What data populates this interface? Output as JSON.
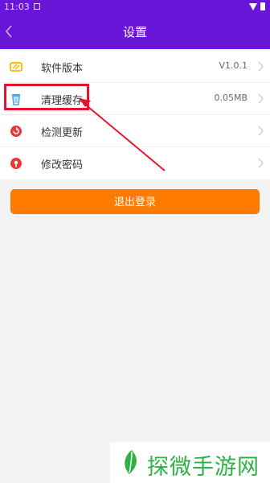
{
  "status_bar": {
    "time": "11:03"
  },
  "header": {
    "title": "设置"
  },
  "settings": [
    {
      "label": "软件版本",
      "value": "V1.0.1",
      "icon": "version-icon",
      "color": "#f5b800"
    },
    {
      "label": "清理缓存",
      "value": "0.05MB",
      "icon": "trash-icon",
      "color": "#4aa5e8"
    },
    {
      "label": "检测更新",
      "value": "",
      "icon": "refresh-icon",
      "color": "#e8383d"
    },
    {
      "label": "修改密码",
      "value": "",
      "icon": "lock-icon",
      "color": "#e8383d"
    }
  ],
  "logout": {
    "label": "退出登录"
  },
  "watermark": {
    "text": "探微手游网"
  },
  "colors": {
    "header": "#6a16d8",
    "accent": "#ff7a00",
    "annotation": "#e3152a",
    "watermark": "#2db142"
  }
}
